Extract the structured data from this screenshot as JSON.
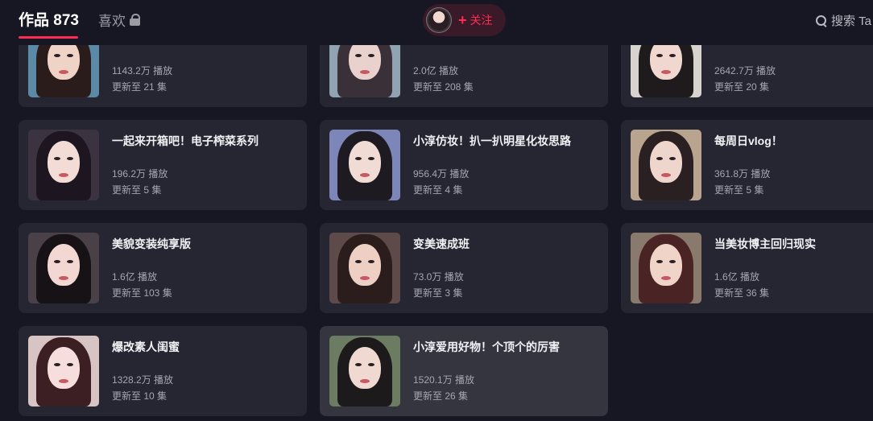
{
  "header": {
    "works_tab": "作品 873",
    "likes_tab": "喜欢",
    "follow_label": "关注",
    "search_label": "搜索 Ta"
  },
  "colors": {
    "accent": "#fe2c55",
    "background": "#161722",
    "card": "#252632",
    "card_hover": "#34353f"
  },
  "cards": [
    {
      "title": "",
      "plays": "1143.2万 播放",
      "episodes": "更新至 21 集",
      "thumb": {
        "bg": "#5a8aa6",
        "hair": "#2b1c1c",
        "skin": "#efd3c6"
      }
    },
    {
      "title": "",
      "plays": "2.0亿 播放",
      "episodes": "更新至 208 集",
      "thumb": {
        "bg": "#8fa3b3",
        "hair": "#3a3037",
        "skin": "#e9d2cd"
      }
    },
    {
      "title": "",
      "plays": "2642.7万 播放",
      "episodes": "更新至 20 集",
      "thumb": {
        "bg": "#d9d3cf",
        "hair": "#1f1a1c",
        "skin": "#f0d8d0"
      }
    },
    {
      "title": "一起来开箱吧！电子榨菜系列",
      "plays": "196.2万 播放",
      "episodes": "更新至 5 集",
      "thumb": {
        "bg": "#3b3340",
        "hair": "#1d1620",
        "skin": "#f3dcd6"
      }
    },
    {
      "title": "小淳仿妆！扒一扒明星化妆思路",
      "plays": "956.4万 播放",
      "episodes": "更新至 4 集",
      "thumb": {
        "bg": "#7c86b8",
        "hair": "#1e1a22",
        "skin": "#f0dcd4"
      }
    },
    {
      "title": "每周日vlog！",
      "plays": "361.8万 播放",
      "episodes": "更新至 5 集",
      "thumb": {
        "bg": "#b9a58f",
        "hair": "#2a2022",
        "skin": "#efd6cc"
      }
    },
    {
      "title": "美貌变装纯享版",
      "plays": "1.6亿 播放",
      "episodes": "更新至 103 集",
      "thumb": {
        "bg": "#4a4048",
        "hair": "#161216",
        "skin": "#f2d7d2"
      }
    },
    {
      "title": "变美速成班",
      "plays": "73.0万 播放",
      "episodes": "更新至 3 集",
      "thumb": {
        "bg": "#5e4a48",
        "hair": "#2a1d1c",
        "skin": "#edcfc4"
      }
    },
    {
      "title": "当美妆博主回归现实",
      "plays": "1.6亿 播放",
      "episodes": "更新至 36 集",
      "thumb": {
        "bg": "#8a7a6e",
        "hair": "#4a2424",
        "skin": "#f1d4c8"
      }
    },
    {
      "title": "爆改素人闺蜜",
      "plays": "1328.2万 播放",
      "episodes": "更新至 10 集",
      "thumb": {
        "bg": "#d8c4c2",
        "hair": "#3b1f22",
        "skin": "#f5dedb"
      }
    },
    {
      "title": "小淳爱用好物！个顶个的厉害",
      "plays": "1520.1万 播放",
      "episodes": "更新至 26 集",
      "thumb": {
        "bg": "#6c7c62",
        "hair": "#1d1a1c",
        "skin": "#efd9d0"
      }
    }
  ]
}
